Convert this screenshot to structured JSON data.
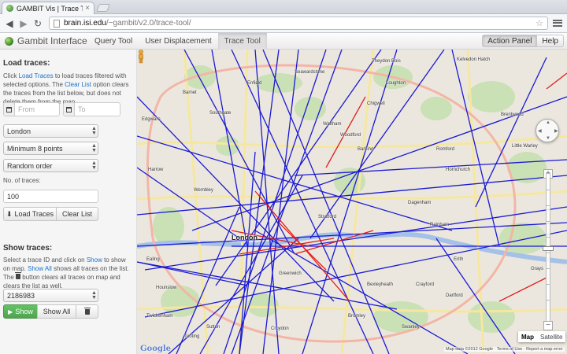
{
  "browser": {
    "tab_title": "GAMBIT Vis | Trace Tool",
    "url_host": "brain.isi.edu",
    "url_path": "/~gambit/v2.0/trace-tool/"
  },
  "navbar": {
    "brand": "Gambit Interface",
    "tabs": [
      "Query Tool",
      "User Displacement",
      "Trace Tool"
    ],
    "active_tab": "Trace Tool",
    "right_buttons": [
      "Action Panel",
      "Help"
    ]
  },
  "load": {
    "heading": "Load traces:",
    "help_pre": "Click ",
    "help_link1": "Load Traces",
    "help_mid": " to load traces filtered with selected options. The ",
    "help_link2": "Clear List",
    "help_post": " option clears the traces from the list below, but does not delete them from the map.",
    "from_placeholder": "From",
    "to_placeholder": "To",
    "city": "London",
    "min_points": "Minimum 8 points",
    "order": "Random order",
    "num_label": "No. of traces:",
    "num_value": "100",
    "load_button": "Load Traces",
    "clear_button": "Clear List"
  },
  "show": {
    "heading": "Show traces:",
    "help_a": "Select a trace ID and click on ",
    "help_link1": "Show",
    "help_b": " to show on map. ",
    "help_link2": "Show All",
    "help_c": " shows all traces on the list. The ",
    "help_d": " button clears all traces on map and clears the list as well.",
    "trace_id": "2186983",
    "show_button": "Show",
    "show_all_button": "Show All"
  },
  "map": {
    "labels": [
      "Barnet",
      "Enfield",
      "Theydon Bois",
      "Kelvedon Hatch",
      "Southgate",
      "Seawardstone",
      "Loughton",
      "Chigwell",
      "Edgware",
      "Waltham",
      "Woodford",
      "Romford",
      "Brentwood",
      "Harrow",
      "Wembley",
      "Barking",
      "Hornchurch",
      "Dagenham",
      "Little Warley",
      "Rainham",
      "Stratford",
      "London",
      "Ealing",
      "Hounslow",
      "Erith",
      "Dartford",
      "Grays",
      "Bexleyheath",
      "Crayford",
      "Croydon",
      "Sutton",
      "Bromley",
      "Swanley",
      "Tooting",
      "Greenwich",
      "Twickenham"
    ],
    "map_type_buttons": [
      "Map",
      "Satellite"
    ],
    "active_map_type": "Map",
    "logo": "Google",
    "attribution": "Map data ©2012 Google · Terms of Use · Report a map error"
  }
}
